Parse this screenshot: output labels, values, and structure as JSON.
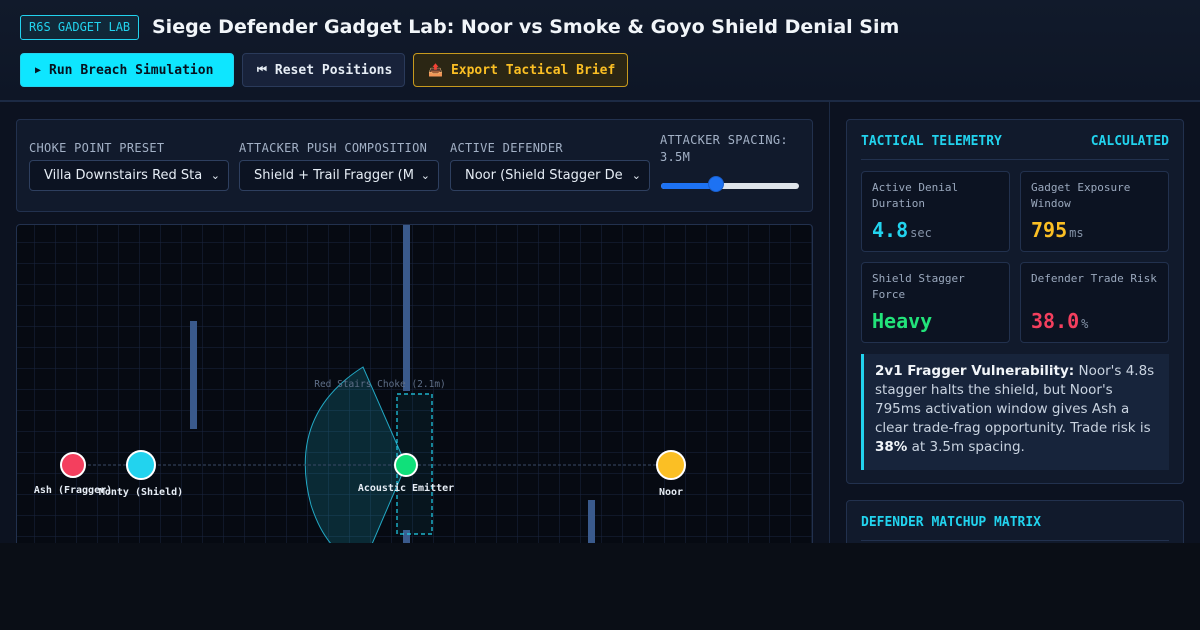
{
  "header": {
    "badge": "R6S GADGET LAB",
    "title": "Siege Defender Gadget Lab: Noor vs Smoke & Goyo Shield Denial Sim",
    "buttons": {
      "run": {
        "icon": "play-icon",
        "glyph": "▶",
        "label": "Run Breach Simulation"
      },
      "reset": {
        "icon": "rewind-icon",
        "glyph": "⏮",
        "label": "Reset Positions"
      },
      "export": {
        "icon": "outbox-tray-icon",
        "glyph": "📤",
        "label": "Export Tactical Brief"
      }
    }
  },
  "controls": {
    "choke_point": {
      "label": "CHOKE POINT PRESET",
      "value": "Villa Downstairs Red Sta"
    },
    "composition": {
      "label": "ATTACKER PUSH COMPOSITION",
      "value": "Shield + Trail Fragger (M"
    },
    "defender": {
      "label": "ACTIVE DEFENDER",
      "value": "Noor (Shield Stagger De"
    },
    "spacing": {
      "label_line1": "ATTACKER SPACING:",
      "label_line2": "3.5M",
      "value_m": 3.5,
      "fill_fraction": 0.4
    }
  },
  "arena": {
    "choke_label": "Red Stairs Choke (2.1m)",
    "units": {
      "ash": {
        "label": "Ash (Fragger)",
        "color": "#f43f5e"
      },
      "monty": {
        "label": "Monty (Shield)",
        "color": "#22d3ee"
      },
      "emitter": {
        "label": "Acoustic Emitter",
        "color": "#10e07a"
      },
      "noor": {
        "label": "Noor",
        "color": "#fbbf24"
      }
    }
  },
  "telemetry": {
    "title": "TACTICAL TELEMETRY",
    "status": "CALCULATED",
    "stats": [
      {
        "label": "Active Denial Duration",
        "value": "4.8",
        "unit": "sec",
        "color": "#22d3ee"
      },
      {
        "label": "Gadget Exposure Window",
        "value": "795",
        "unit": "ms",
        "color": "#fbbf24"
      },
      {
        "label": "Shield Stagger Force",
        "value": "Heavy",
        "unit": "",
        "color": "#22e37a"
      },
      {
        "label": "Defender Trade Risk",
        "value": "38.0",
        "unit": "%",
        "color": "#f43f5e"
      }
    ],
    "note": {
      "lead": "2v1 Fragger Vulnerability:",
      "body": " Noor's 4.8s stagger halts the shield, but Noor's 795ms activation window gives Ash a clear trade-frag opportunity. Trade risk is ",
      "emph": "38%",
      "tail": " at 3.5m spacing."
    }
  },
  "matrix": {
    "title": "DEFENDER MATCHUP MATRIX"
  },
  "colors": {
    "accent": "#22d3ee",
    "warning": "#fbbf24",
    "danger": "#f43f5e",
    "success": "#22e37a"
  }
}
